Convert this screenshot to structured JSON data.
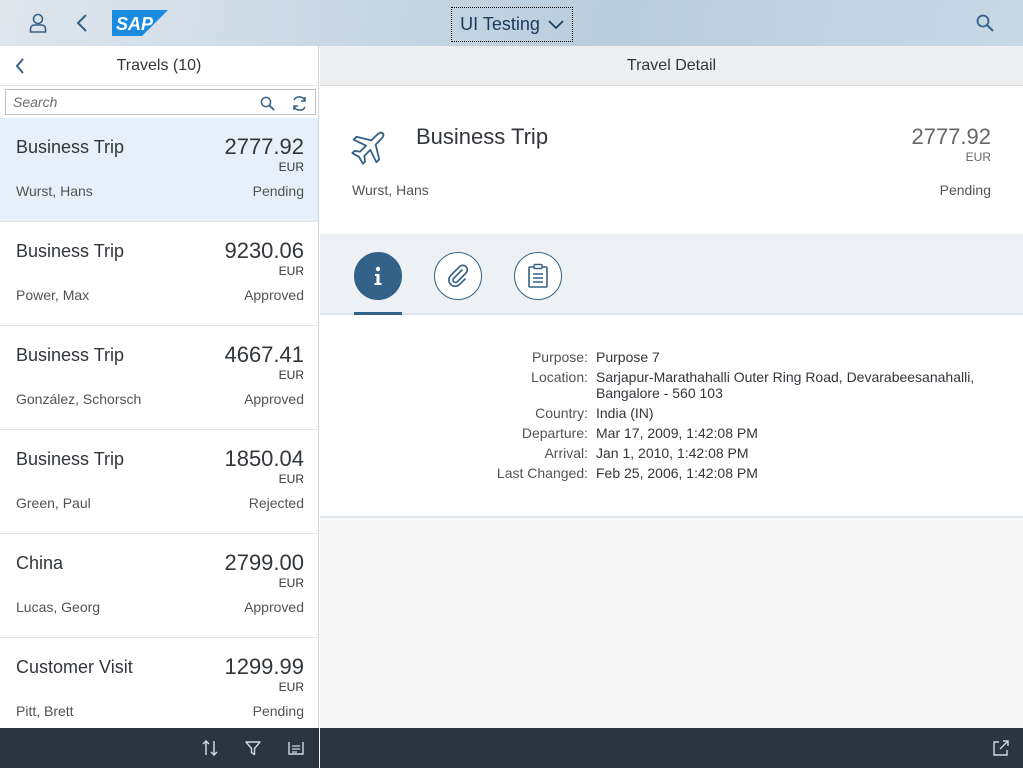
{
  "shell": {
    "app_title": "UI Testing",
    "logo_text": "SAP"
  },
  "master": {
    "title": "Travels (10)",
    "search_placeholder": "Search",
    "items": [
      {
        "title": "Business Trip",
        "amount": "2777.92",
        "currency": "EUR",
        "traveler": "Wurst, Hans",
        "status": "Pending",
        "selected": true
      },
      {
        "title": "Business Trip",
        "amount": "9230.06",
        "currency": "EUR",
        "traveler": "Power, Max",
        "status": "Approved"
      },
      {
        "title": "Business Trip",
        "amount": "4667.41",
        "currency": "EUR",
        "traveler": "González, Schorsch",
        "status": "Approved"
      },
      {
        "title": "Business Trip",
        "amount": "1850.04",
        "currency": "EUR",
        "traveler": "Green, Paul",
        "status": "Rejected"
      },
      {
        "title": "China",
        "amount": "2799.00",
        "currency": "EUR",
        "traveler": "Lucas, Georg",
        "status": "Approved"
      },
      {
        "title": "Customer Visit",
        "amount": "1299.99",
        "currency": "EUR",
        "traveler": "Pitt, Brett",
        "status": "Pending"
      }
    ]
  },
  "detail": {
    "title": "Travel Detail",
    "object": {
      "title": "Business Trip",
      "amount": "2777.92",
      "currency": "EUR",
      "traveler": "Wurst, Hans",
      "status": "Pending"
    },
    "tabs": [
      {
        "name": "info",
        "icon": "info-icon",
        "active": true
      },
      {
        "name": "attachments",
        "icon": "paperclip-icon",
        "active": false
      },
      {
        "name": "notes",
        "icon": "clipboard-icon",
        "active": false
      }
    ],
    "form": {
      "purpose_label": "Purpose:",
      "purpose": "Purpose 7",
      "location_label": "Location:",
      "location": "Sarjapur-Marathahalli Outer Ring Road, Devarabeesanahalli, Bangalore - 560 103",
      "country_label": "Country:",
      "country": "India (IN)",
      "departure_label": "Departure:",
      "departure": "Mar 17, 2009, 1:42:08 PM",
      "arrival_label": "Arrival:",
      "arrival": "Jan 1, 2010, 1:42:08 PM",
      "last_changed_label": "Last Changed:",
      "last_changed": "Feb 25, 2006, 1:42:08 PM"
    }
  },
  "colors": {
    "accent": "#346187",
    "selected_row": "#e5f0fa",
    "footer": "#2b3540",
    "sap_blue": "#0a6ed1"
  }
}
